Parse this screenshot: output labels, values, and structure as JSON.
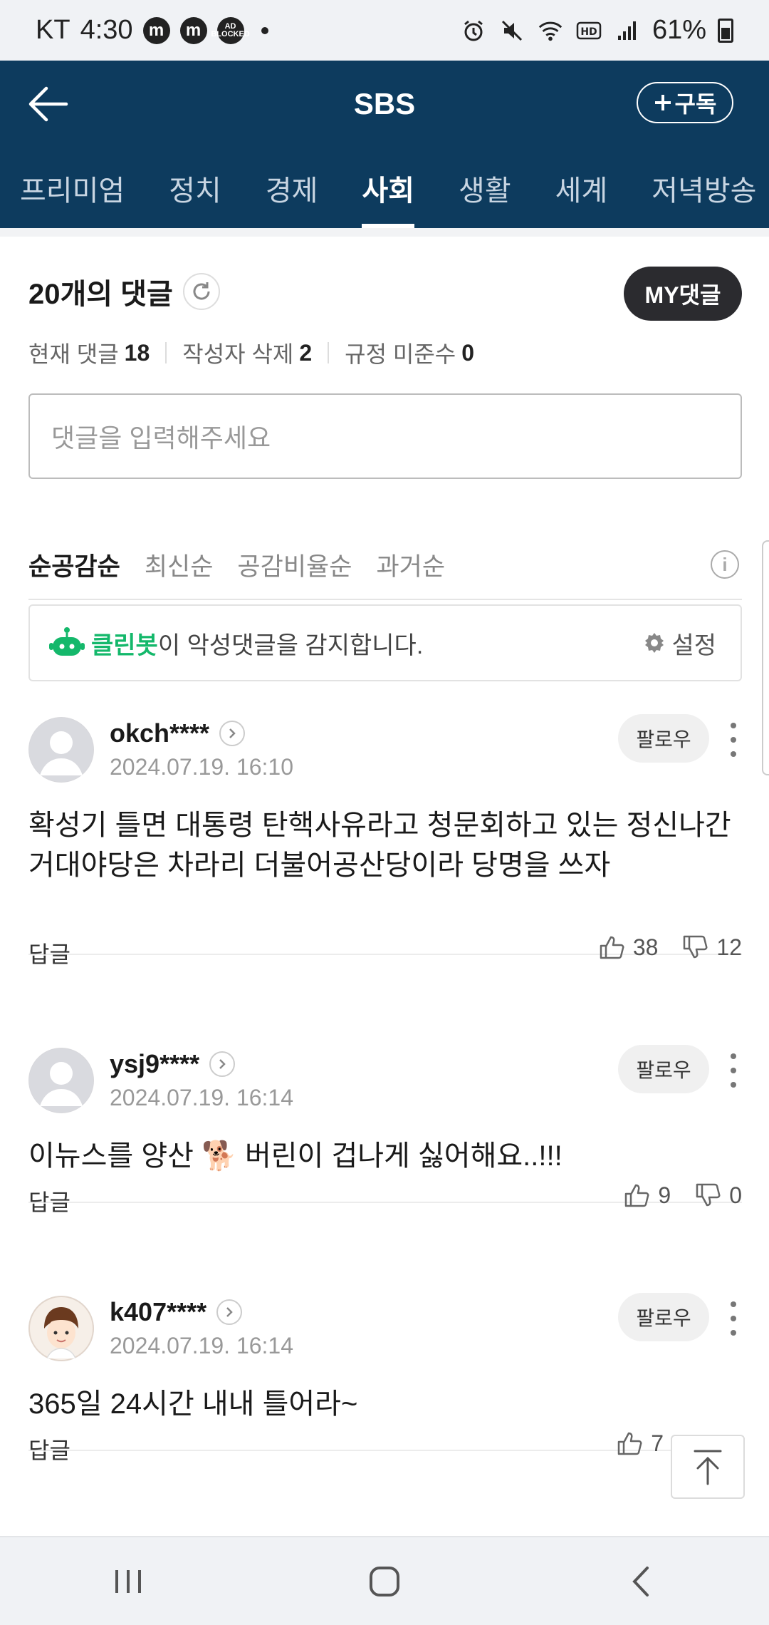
{
  "status_bar": {
    "carrier": "KT",
    "time": "4:30",
    "badges": [
      "m",
      "m",
      "AD BLOCKED"
    ],
    "battery": "61%"
  },
  "header": {
    "title": "SBS",
    "subscribe_label": "구독",
    "accent_color": "#0d3b5e"
  },
  "tabs": [
    {
      "label": "프리미엄"
    },
    {
      "label": "정치"
    },
    {
      "label": "경제"
    },
    {
      "label": "사회",
      "active": true
    },
    {
      "label": "생활"
    },
    {
      "label": "세계"
    },
    {
      "label": "저녁방송"
    }
  ],
  "comments_section": {
    "count_title": "20개의 댓글",
    "my_button": "MY댓글",
    "stats": [
      {
        "label": "현재 댓글",
        "value": "18"
      },
      {
        "label": "작성자 삭제",
        "value": "2"
      },
      {
        "label": "규정 미준수",
        "value": "0"
      }
    ],
    "input_placeholder": "댓글을 입력해주세요",
    "sort_options": [
      {
        "label": "순공감순",
        "active": true
      },
      {
        "label": "최신순"
      },
      {
        "label": "공감비율순"
      },
      {
        "label": "과거순"
      }
    ],
    "cleanbot": {
      "brand": "클린봇",
      "message": "이 악성댓글을 감지합니다.",
      "settings_label": "설정",
      "brand_color": "#14b86b"
    },
    "follow_label": "팔로우",
    "reply_label": "답글",
    "comments": [
      {
        "author": "okch****",
        "date": "2024.07.19. 16:10",
        "text": "확성기 틀면 대통령 탄핵사유라고 청문회하고 있는 정신나간 거대야당은 차라리 더불어공산당이라 당명을 쓰자",
        "likes": "38",
        "dislikes": "12"
      },
      {
        "author": "ysj9****",
        "date": "2024.07.19. 16:14",
        "text": "이뉴스를 양산 🐕 버린이 겁나게 싫어해요..!!!",
        "likes": "9",
        "dislikes": "0"
      },
      {
        "author": "k407****",
        "date": "2024.07.19. 16:14",
        "text": "365일 24시간 내내 틀어라~",
        "likes": "7"
      }
    ]
  }
}
